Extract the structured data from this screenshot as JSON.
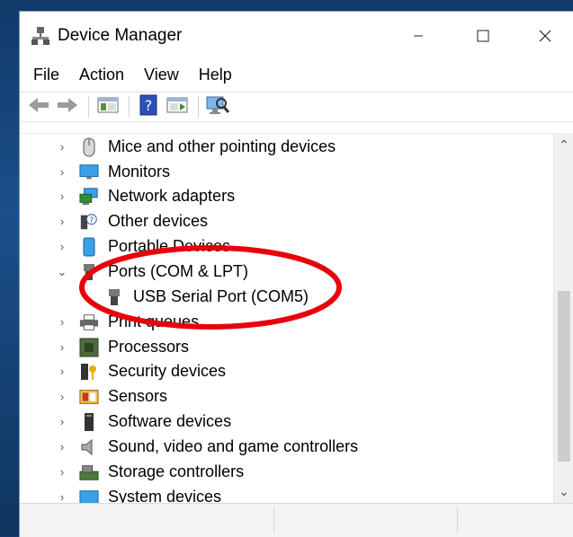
{
  "window": {
    "title": "Device Manager"
  },
  "menu": [
    "File",
    "Action",
    "View",
    "Help"
  ],
  "tree": [
    {
      "label": "Mice and other pointing devices",
      "icon": "mouse-icon",
      "expanded": false
    },
    {
      "label": "Monitors",
      "icon": "monitor-icon",
      "expanded": false
    },
    {
      "label": "Network adapters",
      "icon": "network-adapter-icon",
      "expanded": false
    },
    {
      "label": "Other devices",
      "icon": "unknown-device-icon",
      "expanded": false
    },
    {
      "label": "Portable Devices",
      "icon": "portable-device-icon",
      "expanded": false
    },
    {
      "label": "Ports (COM & LPT)",
      "icon": "port-icon",
      "expanded": true
    },
    {
      "label": "USB Serial Port (COM5)",
      "icon": "serial-port-icon",
      "child": true
    },
    {
      "label": "Print queues",
      "icon": "printer-icon",
      "expanded": false
    },
    {
      "label": "Processors",
      "icon": "processor-icon",
      "expanded": false
    },
    {
      "label": "Security devices",
      "icon": "security-device-icon",
      "expanded": false
    },
    {
      "label": "Sensors",
      "icon": "sensor-icon",
      "expanded": false
    },
    {
      "label": "Software devices",
      "icon": "software-device-icon",
      "expanded": false
    },
    {
      "label": "Sound, video and game controllers",
      "icon": "speaker-icon",
      "expanded": false
    },
    {
      "label": "Storage controllers",
      "icon": "storage-controller-icon",
      "expanded": false
    },
    {
      "label": "System devices",
      "icon": "system-devices-icon",
      "expanded": false
    }
  ],
  "colors": {
    "annotation": "#e8000c",
    "desktop": "#1b4f8a"
  }
}
